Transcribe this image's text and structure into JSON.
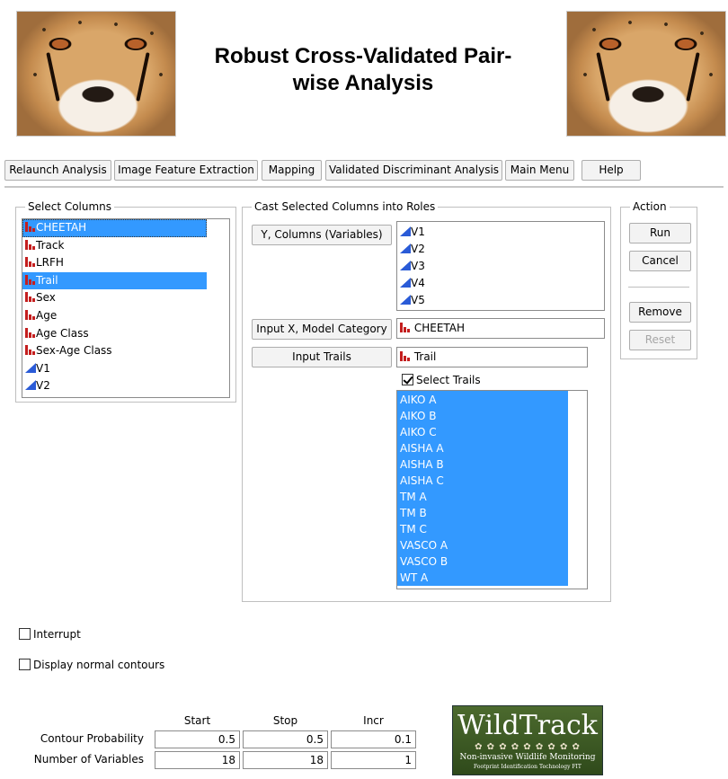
{
  "header": {
    "title_line1": "Robust Cross-Validated Pair-",
    "title_line2": "wise Analysis"
  },
  "toolbar": {
    "buttons": [
      "Relaunch Analysis",
      "Image Feature Extraction",
      "Mapping",
      "Validated Discriminant Analysis",
      "Main Menu",
      "Help"
    ]
  },
  "select_columns": {
    "title": "Select Columns",
    "items": [
      {
        "label": "CHEETAH",
        "type": "nominal",
        "selected": true
      },
      {
        "label": "Track",
        "type": "nominal",
        "selected": false
      },
      {
        "label": "LRFH",
        "type": "nominal",
        "selected": false
      },
      {
        "label": "Trail",
        "type": "nominal",
        "selected": true
      },
      {
        "label": "Sex",
        "type": "nominal",
        "selected": false
      },
      {
        "label": "Age",
        "type": "nominal",
        "selected": false
      },
      {
        "label": "Age Class",
        "type": "nominal",
        "selected": false
      },
      {
        "label": "Sex-Age Class",
        "type": "nominal",
        "selected": false
      },
      {
        "label": "V1",
        "type": "continuous",
        "selected": false
      },
      {
        "label": "V2",
        "type": "continuous",
        "selected": false
      }
    ]
  },
  "cast_roles": {
    "title": "Cast Selected Columns into Roles",
    "y_button": "Y, Columns (Variables)",
    "y_values": [
      "V1",
      "V2",
      "V3",
      "V4",
      "V5"
    ],
    "x_button": "Input X, Model Category",
    "x_value": "CHEETAH",
    "trails_button": "Input Trails",
    "trails_value": "Trail",
    "select_trails_label": "Select Trails",
    "trails": [
      "AIKO A",
      "AIKO B",
      "AIKO C",
      "AISHA A",
      "AISHA B",
      "AISHA C",
      "TM A",
      "TM B",
      "TM C",
      "VASCO A",
      "VASCO B",
      "WT A"
    ]
  },
  "action": {
    "title": "Action",
    "run": "Run",
    "cancel": "Cancel",
    "remove": "Remove",
    "reset": "Reset"
  },
  "options": {
    "interrupt": "Interrupt",
    "display_contours": "Display normal contours"
  },
  "params": {
    "headers": [
      "Start",
      "Stop",
      "Incr"
    ],
    "rows": [
      {
        "label": "Contour Probability",
        "values": [
          "0.5",
          "0.5",
          "0.1"
        ]
      },
      {
        "label": "Number of Variables",
        "values": [
          "18",
          "18",
          "1"
        ]
      }
    ]
  },
  "logo": {
    "text": "WildTrack",
    "line1": "Non-invasive Wildlife Monitoring",
    "line2": "Footprint Identification Technology FIT"
  },
  "colors": {
    "selection": "#3399ff",
    "nominal_icon": "#c41e1e",
    "continuous_icon": "#2a5bd7"
  }
}
